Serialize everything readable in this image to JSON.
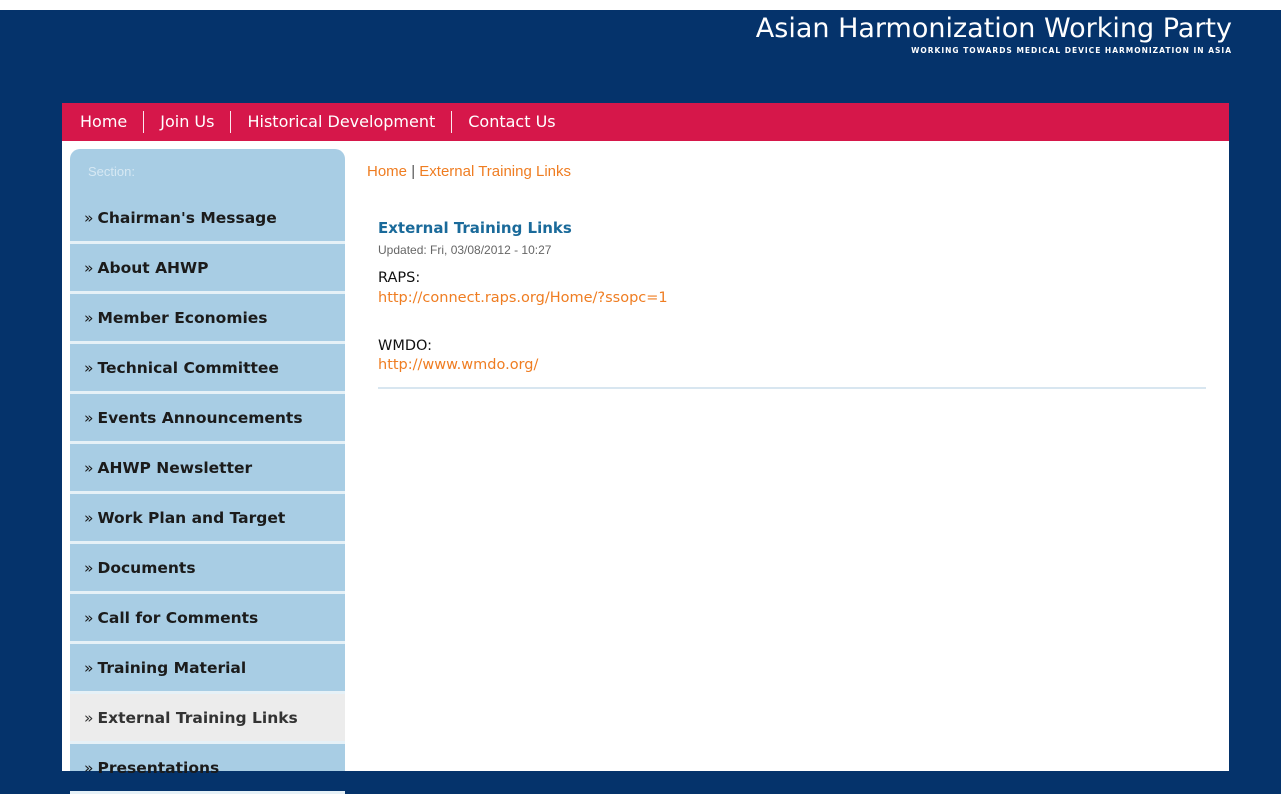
{
  "brand": {
    "title": "Asian Harmonization Working Party",
    "tagline": "WORKING TOWARDS MEDICAL DEVICE HARMONIZATION IN ASIA"
  },
  "nav": {
    "items": [
      {
        "label": "Home"
      },
      {
        "label": "Join Us"
      },
      {
        "label": "Historical Development"
      },
      {
        "label": "Contact Us"
      }
    ]
  },
  "sidebar": {
    "header": "Section:",
    "items": [
      {
        "label": "Chairman's Message"
      },
      {
        "label": "About AHWP"
      },
      {
        "label": "Member Economies"
      },
      {
        "label": "Technical Committee"
      },
      {
        "label": "Events Announcements"
      },
      {
        "label": "AHWP Newsletter"
      },
      {
        "label": "Work Plan and Target"
      },
      {
        "label": "Documents"
      },
      {
        "label": "Call for Comments"
      },
      {
        "label": "Training Material"
      },
      {
        "label": "External Training Links",
        "active": true
      },
      {
        "label": "Presentations"
      }
    ]
  },
  "breadcrumb": {
    "home": "Home",
    "separator": "|",
    "current": "External Training Links"
  },
  "article": {
    "title": "External Training Links",
    "updated": "Updated: Fri, 03/08/2012 - 10:27",
    "entries": [
      {
        "label": "RAPS:",
        "link": "http://connect.raps.org/Home/?ssopc=1"
      },
      {
        "label": "WMDO:",
        "link": "http://www.wmdo.org/"
      }
    ]
  },
  "colors": {
    "background": "#05336b",
    "nav": "#d6174a",
    "sidebar": "#a8cde4",
    "accent_orange": "#ef7d22",
    "title_blue": "#1a6a9a"
  }
}
